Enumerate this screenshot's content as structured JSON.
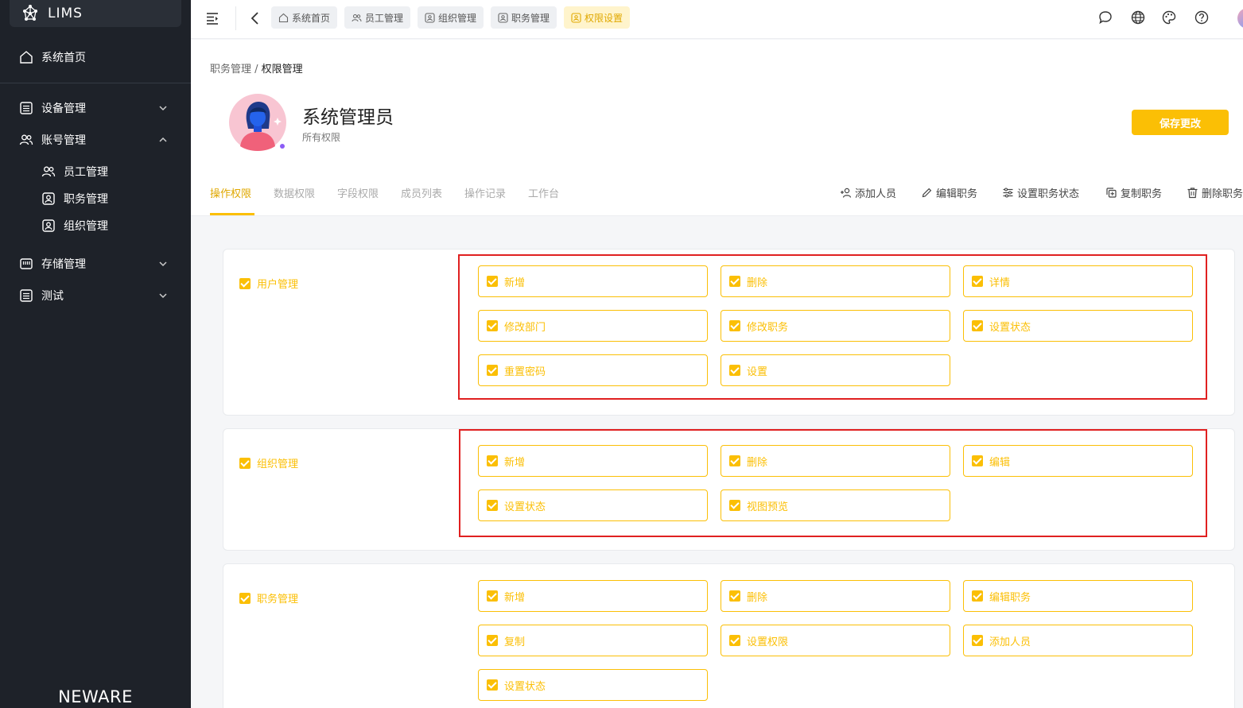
{
  "app": {
    "logo_text": "LIMS",
    "footer_brand": "NEWARE"
  },
  "sidebar": {
    "home": "系统首页",
    "menus": [
      {
        "label": "设备管理",
        "expanded": false
      },
      {
        "label": "账号管理",
        "expanded": true
      },
      {
        "label": "存储管理",
        "expanded": false
      },
      {
        "label": "测试",
        "expanded": false
      }
    ],
    "sub_items": [
      "员工管理",
      "职务管理",
      "组织管理"
    ]
  },
  "topbar": {
    "tabs": [
      {
        "label": "系统首页",
        "icon": "home-icon"
      },
      {
        "label": "员工管理",
        "icon": "users-icon"
      },
      {
        "label": "组织管理",
        "icon": "badge-icon"
      },
      {
        "label": "职务管理",
        "icon": "badge-icon"
      },
      {
        "label": "权限设置",
        "icon": "badge-icon",
        "active": true
      }
    ],
    "right_icons": [
      "message-icon",
      "globe-icon",
      "palette-icon",
      "help-icon"
    ]
  },
  "breadcrumb": {
    "parent": "职务管理",
    "separator": " / ",
    "current": "权限管理"
  },
  "profile": {
    "name": "系统管理员",
    "subtitle": "所有权限"
  },
  "save_label": "保存更改",
  "nav_tabs": [
    "操作权限",
    "数据权限",
    "字段权限",
    "成员列表",
    "操作记录",
    "工作台"
  ],
  "actions": [
    {
      "label": "添加人员",
      "icon": "add-user-icon"
    },
    {
      "label": "编辑职务",
      "icon": "pencil-icon"
    },
    {
      "label": "设置职务状态",
      "icon": "sliders-icon"
    },
    {
      "label": "复制职务",
      "icon": "copy-icon"
    },
    {
      "label": "删除职务",
      "icon": "trash-icon"
    }
  ],
  "groups": [
    {
      "name": "用户管理",
      "permissions": [
        "新增",
        "删除",
        "详情",
        "修改部门",
        "修改职务",
        "设置状态",
        "重置密码",
        "设置"
      ]
    },
    {
      "name": "组织管理",
      "permissions": [
        "新增",
        "删除",
        "编辑",
        "设置状态",
        "视图预览"
      ]
    },
    {
      "name": "职务管理",
      "permissions": [
        "新增",
        "删除",
        "编辑职务",
        "复制",
        "设置权限",
        "添加人员",
        "设置状态"
      ]
    }
  ],
  "colors": {
    "accent": "#fbbf05",
    "sidebar_bg": "#1e2229",
    "highlight_box": "#e02020"
  }
}
